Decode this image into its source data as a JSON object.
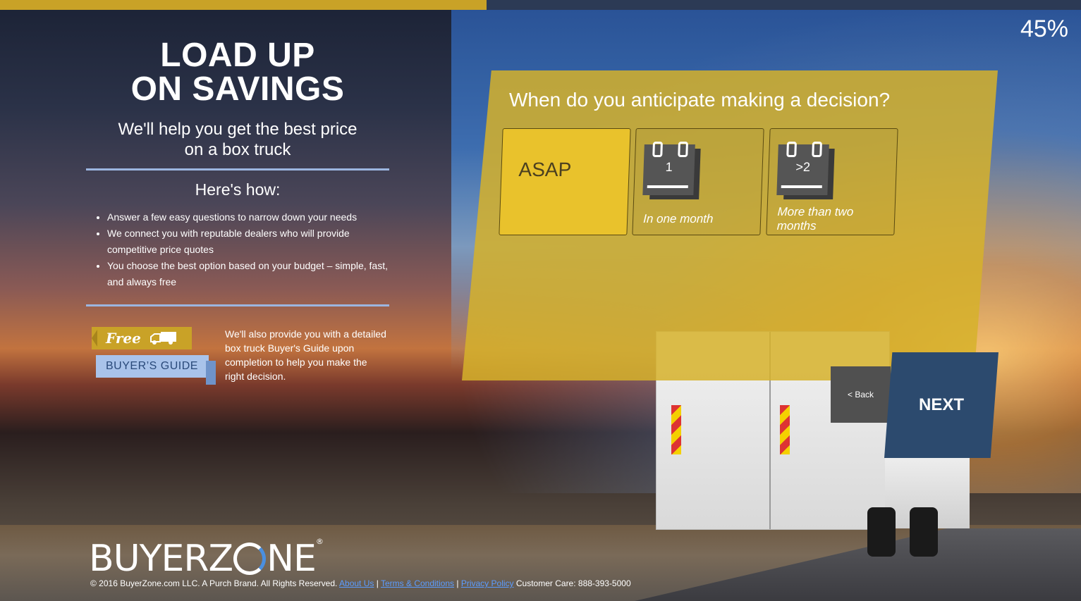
{
  "progress": {
    "percent_value": 45,
    "label": "45%"
  },
  "left": {
    "headline_line1": "LOAD UP",
    "headline_line2": "ON SAVINGS",
    "subhead_line1": "We'll help you get the best price",
    "subhead_line2": "on a box truck",
    "howto_title": "Here's how:",
    "bullets": [
      "Answer a few easy questions to narrow down your needs",
      "We connect you with reputable dealers who will provide competitive price quotes",
      "You choose the best option based on your budget – simple, fast, and always free"
    ]
  },
  "guide": {
    "ribbon_top": "Free",
    "ribbon_bottom": "BUYER’S GUIDE",
    "text": "We'll also provide you with a detailed box truck Buyer's Guide upon completion to help you make the right decision."
  },
  "question": {
    "text": "When do you anticipate making a decision?",
    "options": [
      {
        "label": "ASAP",
        "selected": true
      },
      {
        "calendar": "1",
        "label": "In one month",
        "selected": false
      },
      {
        "calendar": ">2",
        "label": "More than two months",
        "selected": false
      }
    ]
  },
  "nav": {
    "back_label": "< Back",
    "next_label": "NEXT"
  },
  "brand": {
    "logo_left": "BUYERZ",
    "logo_right": "NE",
    "registered": "®"
  },
  "footer": {
    "copyright": "© 2016 BuyerZone.com LLC. A Purch Brand. All Rights Reserved.",
    "about": "About Us",
    "sep": "|",
    "terms": "Terms & Conditions",
    "privacy": "Privacy Policy",
    "care": "Customer Care: 888-393-5000"
  },
  "colors": {
    "accent_gold": "#c9a227",
    "next_blue": "#2c4a6e",
    "rule_blue": "#9cb6e0"
  }
}
